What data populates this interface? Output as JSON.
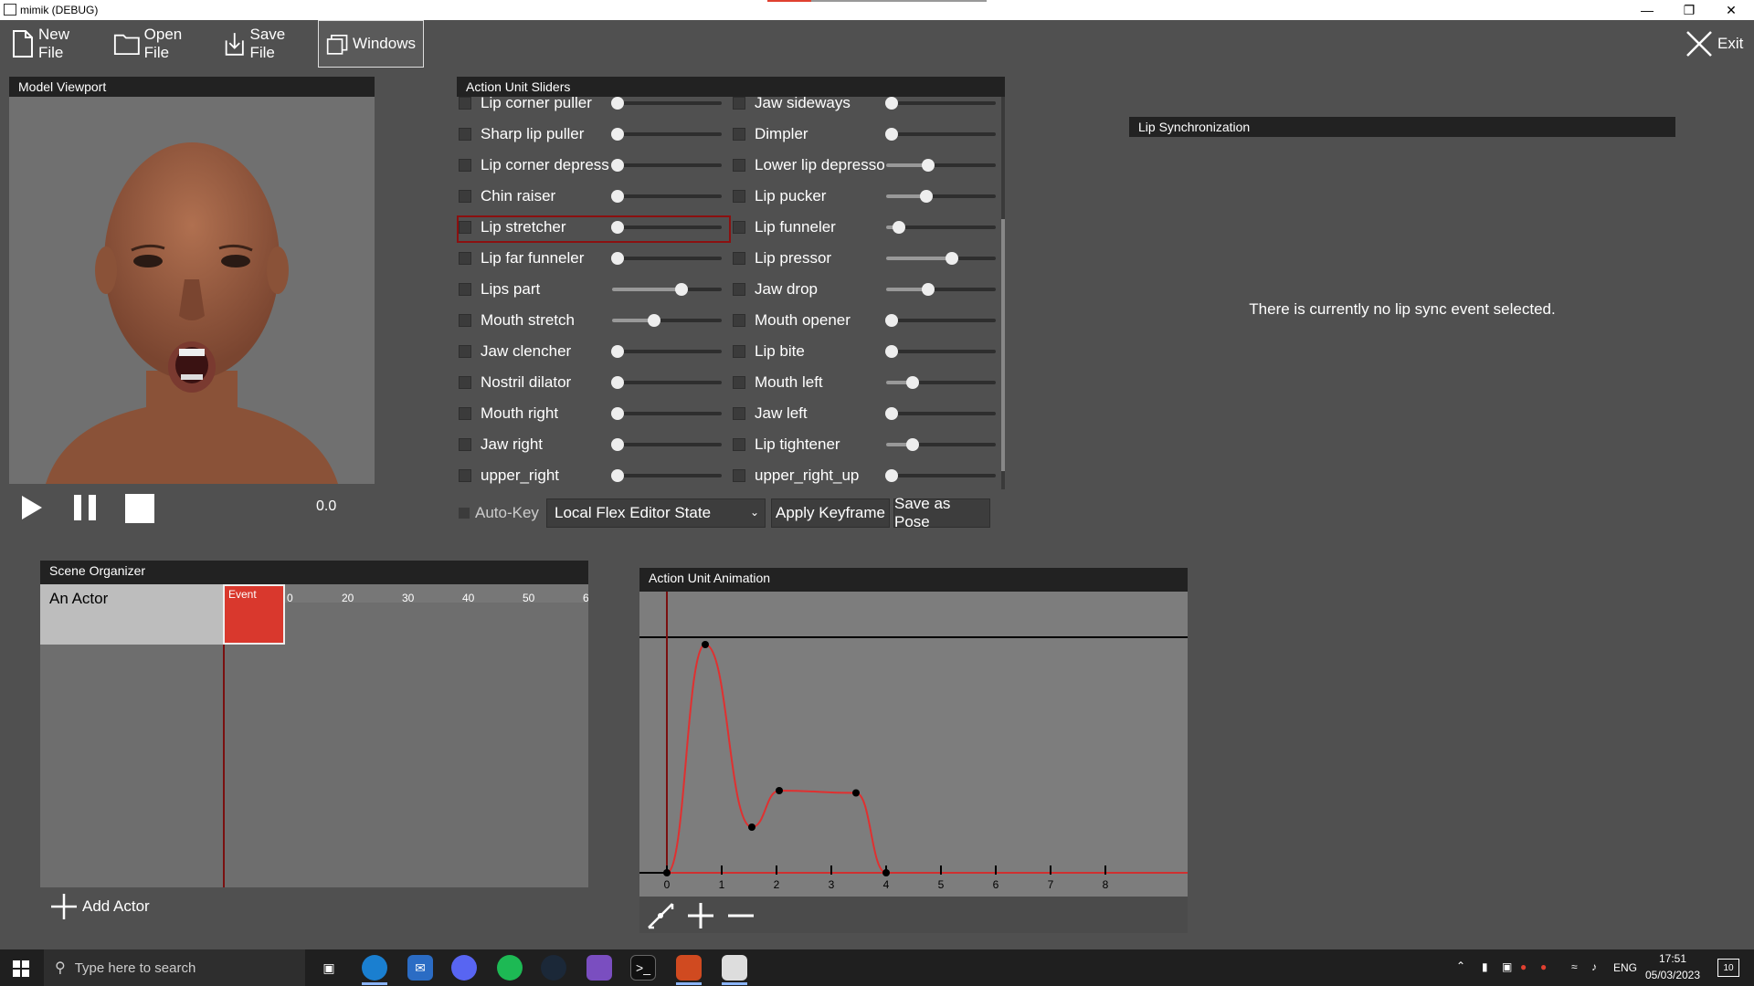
{
  "window": {
    "title": "mimik (DEBUG)",
    "minimize_icon": "minimize-icon",
    "restore_icon": "restore-icon",
    "close_icon": "close-icon"
  },
  "toolbar": {
    "new_file": "New File",
    "open_file": "Open File",
    "save_file": "Save File",
    "windows": "Windows",
    "exit": "Exit"
  },
  "viewport": {
    "title": "Model Viewport",
    "time": "0.0"
  },
  "sliders": {
    "title": "Action Unit Sliders",
    "left": [
      {
        "label": "Lip corner puller",
        "value": 0.05,
        "partial": true
      },
      {
        "label": "Sharp lip puller",
        "value": 0.05
      },
      {
        "label": "Lip corner depress",
        "value": 0.05
      },
      {
        "label": "Chin raiser",
        "value": 0.05
      },
      {
        "label": "Lip stretcher",
        "value": 0.05,
        "selected": true
      },
      {
        "label": "Lip far funneler",
        "value": 0.05
      },
      {
        "label": "Lips part",
        "value": 0.63
      },
      {
        "label": "Mouth stretch",
        "value": 0.38
      },
      {
        "label": "Jaw clencher",
        "value": 0.05
      },
      {
        "label": "Nostril dilator",
        "value": 0.05
      },
      {
        "label": "Mouth right",
        "value": 0.05
      },
      {
        "label": "Jaw right",
        "value": 0.05
      },
      {
        "label": "upper_right",
        "value": 0.05
      }
    ],
    "right": [
      {
        "label": "Jaw sideways",
        "value": 0.05,
        "partial": true
      },
      {
        "label": "Dimpler",
        "value": 0.05
      },
      {
        "label": "Lower lip depresso",
        "value": 0.38
      },
      {
        "label": "Lip pucker",
        "value": 0.37
      },
      {
        "label": "Lip funneler",
        "value": 0.12
      },
      {
        "label": "Lip pressor",
        "value": 0.6
      },
      {
        "label": "Jaw drop",
        "value": 0.38
      },
      {
        "label": "Mouth opener",
        "value": 0.05
      },
      {
        "label": "Lip bite",
        "value": 0.05
      },
      {
        "label": "Mouth left",
        "value": 0.24
      },
      {
        "label": "Jaw left",
        "value": 0.05
      },
      {
        "label": "Lip tightener",
        "value": 0.24
      },
      {
        "label": "upper_right_up",
        "value": 0.05
      }
    ],
    "auto_key": "Auto-Key",
    "state_select": "Local Flex Editor State",
    "apply_keyframe": "Apply Keyframe",
    "save_as_pose": "Save as Pose"
  },
  "lipsync": {
    "title": "Lip Synchronization",
    "message": "There is currently no lip sync event selected."
  },
  "scene": {
    "title": "Scene Organizer",
    "actor": "An Actor",
    "event": "Event",
    "ticks": [
      "0",
      "20",
      "30",
      "40",
      "50",
      "6"
    ],
    "add_actor": "Add Actor"
  },
  "animation": {
    "title": "Action Unit Animation",
    "ticks": [
      "0",
      "1",
      "2",
      "3",
      "4",
      "5",
      "6",
      "7",
      "8"
    ],
    "keyframes": [
      [
        0,
        0
      ],
      [
        0.7,
        1.0
      ],
      [
        1.55,
        0.2
      ],
      [
        2.05,
        0.36
      ],
      [
        3.45,
        0.35
      ],
      [
        4.0,
        0
      ]
    ]
  },
  "taskbar": {
    "search_placeholder": "Type here to search",
    "language": "ENG",
    "time": "17:51",
    "date": "05/03/2023",
    "notifications": "10"
  }
}
